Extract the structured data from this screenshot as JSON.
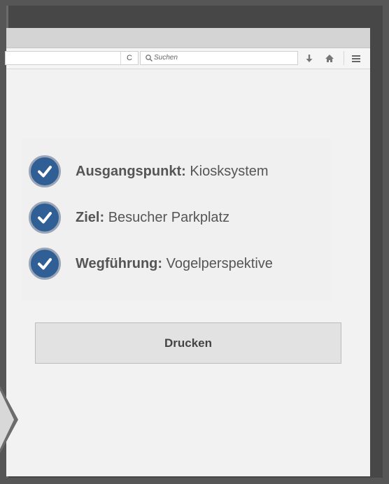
{
  "browser": {
    "search": {
      "placeholder": "Suchen"
    },
    "reload_glyph": "C",
    "icons": [
      "reload-icon",
      "search-icon",
      "download-icon",
      "home-icon",
      "hamburger-menu-icon"
    ]
  },
  "checklist": {
    "items": [
      {
        "label": "Ausgangspunkt:",
        "value": "Kiosksystem"
      },
      {
        "label": "Ziel:",
        "value": "Besucher Parkplatz"
      },
      {
        "label": "Wegführung:",
        "value": "Vogelperspektive"
      }
    ],
    "icon": "checkmark-circle-icon"
  },
  "actions": {
    "print_label": "Drucken"
  },
  "colors": {
    "check_badge": "#2f5f94",
    "check_border": "#9aa6b6",
    "page_background": "#f2f2f2",
    "frame": "#474747",
    "button": "#e2e2e2"
  }
}
